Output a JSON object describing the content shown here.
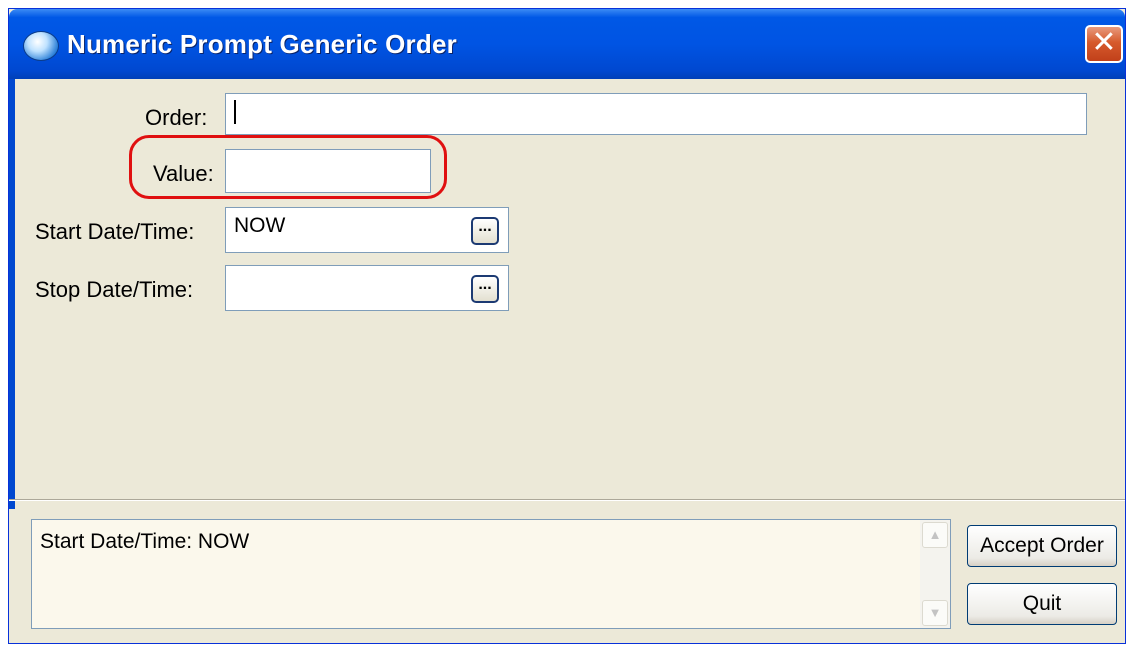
{
  "window": {
    "title": "Numeric Prompt Generic Order",
    "close_symbol": "✕",
    "icon": "app-globe-icon"
  },
  "form": {
    "order": {
      "label": "Order:",
      "value": "",
      "placeholder": ""
    },
    "value": {
      "label": "Value:",
      "value": ""
    },
    "start_datetime": {
      "label": "Start Date/Time:",
      "value": "NOW",
      "browse_label": "..."
    },
    "stop_datetime": {
      "label": "Stop Date/Time:",
      "value": "",
      "browse_label": "..."
    }
  },
  "status": {
    "text": "Start Date/Time:  NOW"
  },
  "buttons": {
    "accept_label": "Accept Order",
    "quit_label": "Quit"
  },
  "colors": {
    "titlebar": "#0054e3",
    "dialog_bg": "#ece9d8",
    "highlight": "#e01010"
  }
}
